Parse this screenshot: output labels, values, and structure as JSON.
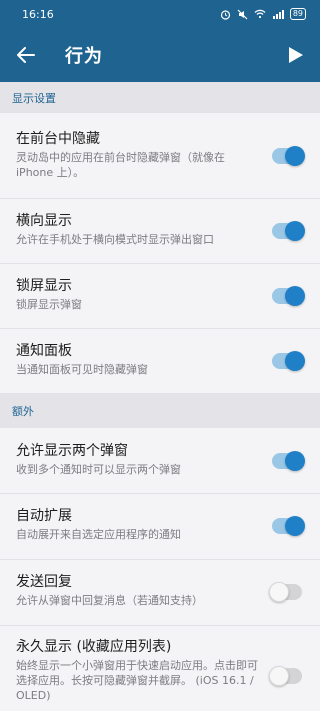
{
  "status_bar": {
    "time": "16:16",
    "battery": "89"
  },
  "app_bar": {
    "title": "行为"
  },
  "sections": [
    {
      "header": "显示设置",
      "items": [
        {
          "title": "在前台中隐藏",
          "subtitle": "灵动岛中的应用在前台时隐藏弹窗（就像在 iPhone 上）。",
          "enabled": true
        },
        {
          "title": "横向显示",
          "subtitle": "允许在手机处于横向模式时显示弹出窗口",
          "enabled": true
        },
        {
          "title": "锁屏显示",
          "subtitle": "锁屏显示弹窗",
          "enabled": true
        },
        {
          "title": "通知面板",
          "subtitle": "当通知面板可见时隐藏弹窗",
          "enabled": true
        }
      ]
    },
    {
      "header": "额外",
      "items": [
        {
          "title": "允许显示两个弹窗",
          "subtitle": "收到多个通知时可以显示两个弹窗",
          "enabled": true
        },
        {
          "title": "自动扩展",
          "subtitle": "自动展开来自选定应用程序的通知",
          "enabled": true
        },
        {
          "title": "发送回复",
          "subtitle": "允许从弹窗中回复消息（若通知支持）",
          "enabled": false
        },
        {
          "title": "永久显示 (收藏应用列表)",
          "subtitle": "始终显示一个小弹窗用于快速启动应用。点击即可选择应用。长按可隐藏弹窗并截屏。 (iOS 16.1 / OLED)",
          "enabled": false
        }
      ]
    }
  ],
  "colors": {
    "accent": "#1f6391",
    "toggle_on": "#1f80c8",
    "toggle_on_track": "#9ac7e6"
  }
}
